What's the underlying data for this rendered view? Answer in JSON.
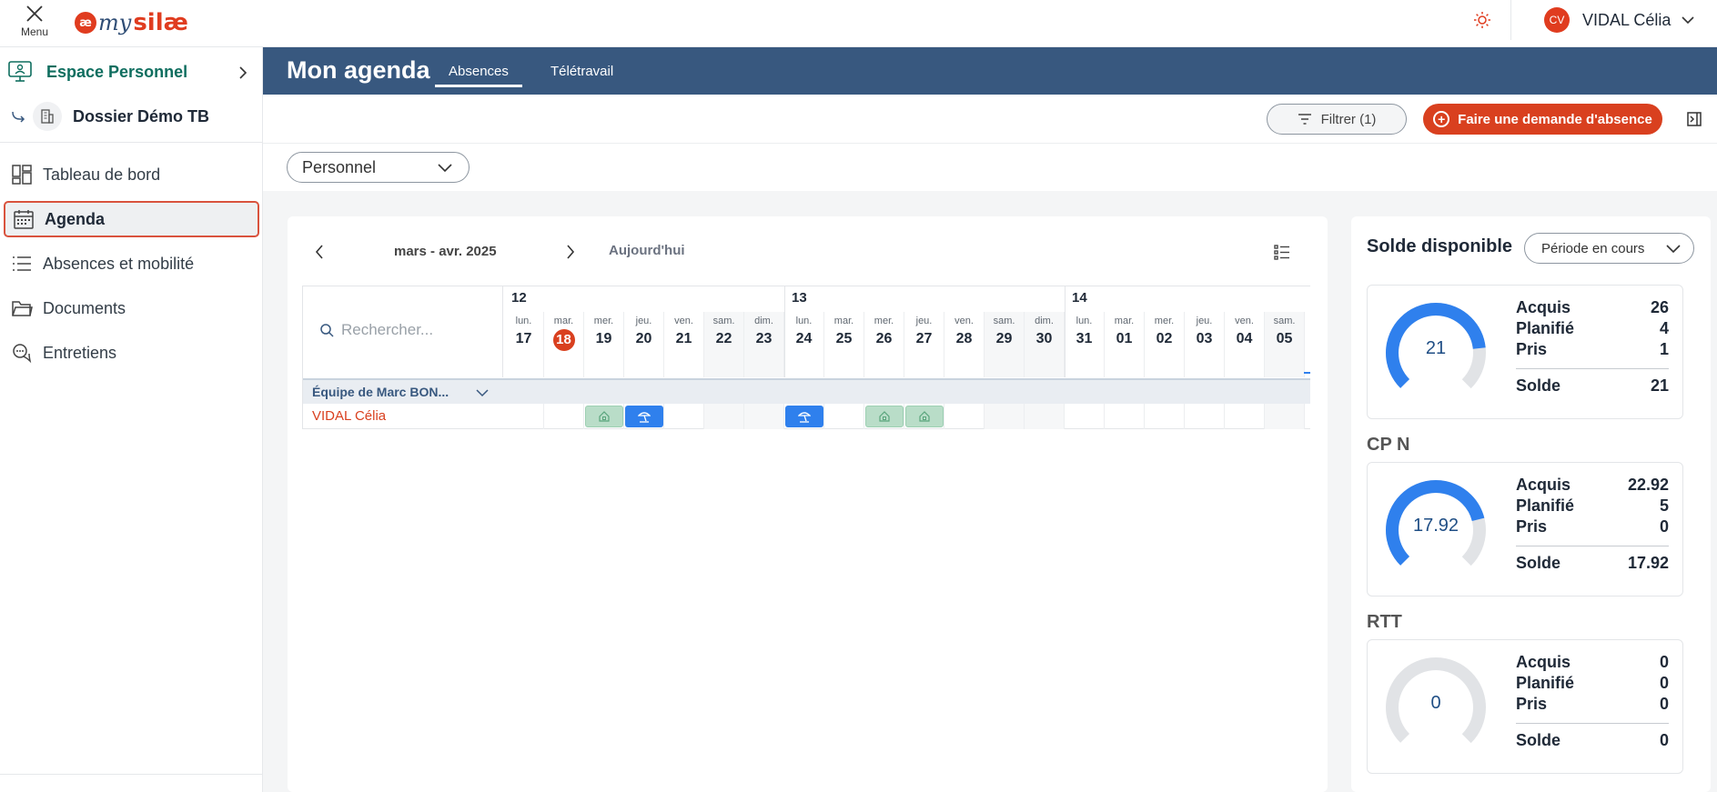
{
  "topbar": {
    "menu_label": "Menu",
    "logo_ae": "æ",
    "logo_my": "my",
    "logo_silae": "silæ",
    "user_initials": "CV",
    "user_name": "VIDAL Célia"
  },
  "sidebar": {
    "espace": "Espace Personnel",
    "dossier": "Dossier Démo TB",
    "items": [
      {
        "label": "Tableau de bord",
        "icon": "dashboard-icon",
        "active": false
      },
      {
        "label": "Agenda",
        "icon": "calendar-icon",
        "active": true
      },
      {
        "label": "Absences et mobilité",
        "icon": "list-icon",
        "active": false
      },
      {
        "label": "Documents",
        "icon": "folder-icon",
        "active": false
      },
      {
        "label": "Entretiens",
        "icon": "chat-icon",
        "active": false
      }
    ]
  },
  "header": {
    "title": "Mon agenda",
    "tabs": [
      {
        "label": "Absences",
        "active": true
      },
      {
        "label": "Télétravail",
        "active": false
      }
    ]
  },
  "toolbar": {
    "filter_label": "Filtrer (1)",
    "demand_label": "Faire une demande d'absence"
  },
  "view_select": {
    "value": "Personnel"
  },
  "calendar": {
    "range": "mars - avr. 2025",
    "today_label": "Aujourd'hui",
    "search_placeholder": "Rechercher...",
    "weeks": [
      "12",
      "13",
      "14"
    ],
    "days": [
      {
        "name": "lun.",
        "num": "17"
      },
      {
        "name": "mar.",
        "num": "18"
      },
      {
        "name": "mer.",
        "num": "19"
      },
      {
        "name": "jeu.",
        "num": "20"
      },
      {
        "name": "ven.",
        "num": "21"
      },
      {
        "name": "sam.",
        "num": "22"
      },
      {
        "name": "dim.",
        "num": "23"
      },
      {
        "name": "lun.",
        "num": "24"
      },
      {
        "name": "mar.",
        "num": "25"
      },
      {
        "name": "mer.",
        "num": "26"
      },
      {
        "name": "jeu.",
        "num": "27"
      },
      {
        "name": "ven.",
        "num": "28"
      },
      {
        "name": "sam.",
        "num": "29"
      },
      {
        "name": "dim.",
        "num": "30"
      },
      {
        "name": "lun.",
        "num": "31"
      },
      {
        "name": "mar.",
        "num": "01"
      },
      {
        "name": "mer.",
        "num": "02"
      },
      {
        "name": "jeu.",
        "num": "03"
      },
      {
        "name": "ven.",
        "num": "04"
      },
      {
        "name": "sam.",
        "num": "05"
      }
    ],
    "today_num": "18",
    "team": "Équipe de Marc BON...",
    "person": "VIDAL Célia",
    "events": [
      {
        "day": "19",
        "type": "teletravail",
        "icon": "home-icon"
      },
      {
        "day": "20",
        "type": "absence",
        "icon": "beach-umbrella-icon"
      },
      {
        "day": "24",
        "type": "absence",
        "icon": "beach-umbrella-icon"
      },
      {
        "day": "26",
        "type": "teletravail",
        "icon": "home-icon"
      },
      {
        "day": "27",
        "type": "teletravail",
        "icon": "home-icon"
      }
    ]
  },
  "solde": {
    "title": "Solde disponible",
    "period": "Période en cours",
    "cards": [
      {
        "title": "",
        "value": "21",
        "acquis": "26",
        "planifie": "4",
        "pris": "1",
        "solde": "21",
        "fill_fraction": 0.81
      },
      {
        "title": "CP N",
        "value": "17.92",
        "acquis": "22.92",
        "planifie": "5",
        "pris": "0",
        "solde": "17.92",
        "fill_fraction": 0.78
      },
      {
        "title": "RTT",
        "value": "0",
        "acquis": "0",
        "planifie": "0",
        "pris": "0",
        "solde": "0",
        "fill_fraction": 0
      }
    ],
    "labels": {
      "acquis": "Acquis",
      "planifie": "Planifié",
      "pris": "Pris",
      "solde": "Solde"
    }
  },
  "colors": {
    "brand": "#e03c1f",
    "header": "#38587f",
    "gauge": "#2f80ed",
    "teletravail": "#b9ddc8"
  }
}
